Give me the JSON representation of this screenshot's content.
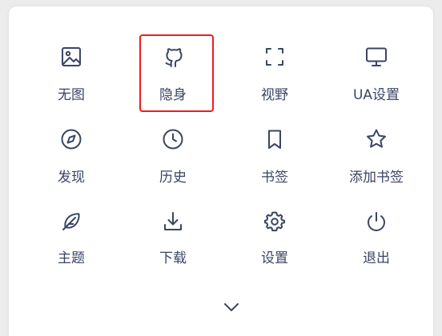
{
  "menu": {
    "items": [
      {
        "label": "无图",
        "icon": "image-icon"
      },
      {
        "label": "隐身",
        "icon": "github-icon"
      },
      {
        "label": "视野",
        "icon": "fullscreen-icon"
      },
      {
        "label": "UA设置",
        "icon": "monitor-icon"
      },
      {
        "label": "发现",
        "icon": "compass-icon"
      },
      {
        "label": "历史",
        "icon": "clock-icon"
      },
      {
        "label": "书签",
        "icon": "bookmark-icon"
      },
      {
        "label": "添加书签",
        "icon": "star-icon"
      },
      {
        "label": "主题",
        "icon": "feather-icon"
      },
      {
        "label": "下载",
        "icon": "download-icon"
      },
      {
        "label": "设置",
        "icon": "gear-icon"
      },
      {
        "label": "退出",
        "icon": "power-icon"
      }
    ],
    "expand_icon": "chevron-down-icon"
  },
  "colors": {
    "icon_and_text": "#3a4566",
    "highlight_border": "#ee1c1c",
    "panel_background": "#ffffff",
    "page_background": "#ececec"
  }
}
